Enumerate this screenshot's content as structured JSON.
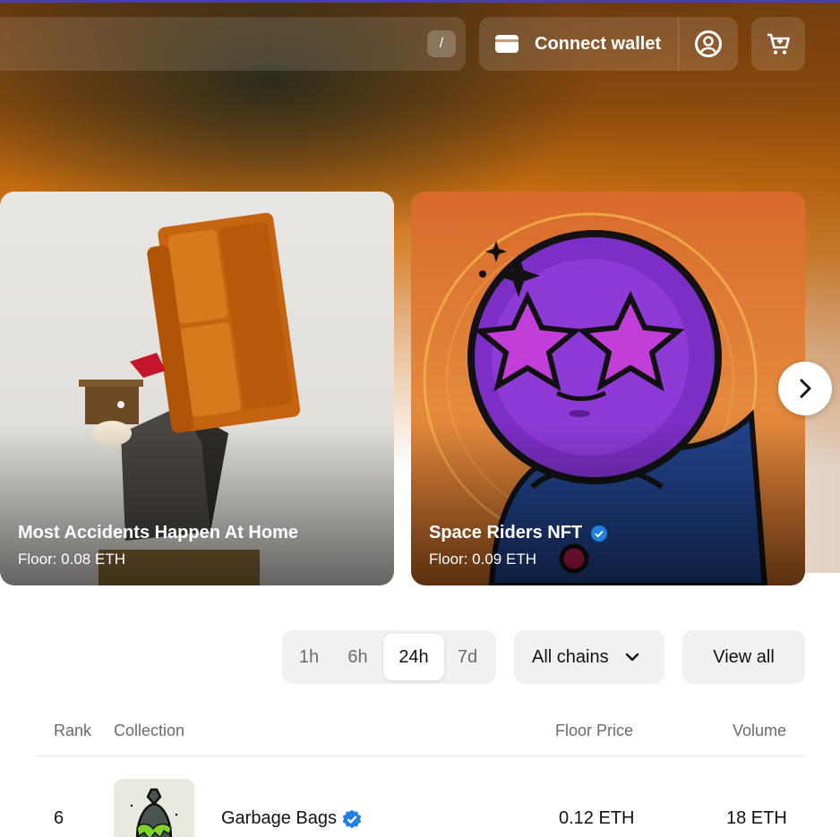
{
  "header": {
    "search_shortcut": "/",
    "connect_wallet_label": "Connect wallet"
  },
  "carousel": {
    "cards": [
      {
        "title": "Most Accidents Happen At Home",
        "floor": "Floor: 0.08 ETH",
        "verified": false
      },
      {
        "title": "Space Riders NFT",
        "floor": "Floor: 0.09 ETH",
        "verified": true
      }
    ]
  },
  "filters": {
    "time_tabs": [
      "1h",
      "6h",
      "24h",
      "7d"
    ],
    "selected_time": "24h",
    "chains_label": "All chains",
    "view_all_label": "View all"
  },
  "table": {
    "headers": {
      "rank": "Rank",
      "collection": "Collection",
      "floor_price": "Floor Price",
      "volume": "Volume"
    },
    "rows": [
      {
        "rank": "6",
        "collection": "Garbage Bags",
        "verified": true,
        "floor_price": "0.12 ETH",
        "volume": "18 ETH"
      }
    ]
  },
  "colors": {
    "accent_blue": "#2081e2",
    "top_line": "#4a3fa8"
  }
}
